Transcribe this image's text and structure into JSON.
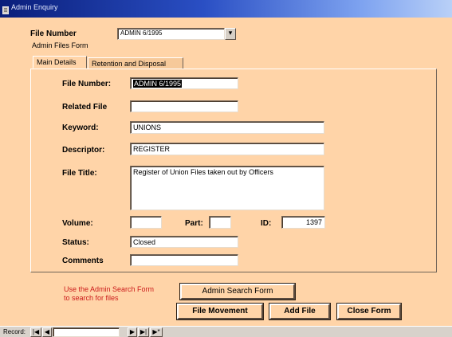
{
  "window": {
    "title": "Admin Enquiry"
  },
  "header": {
    "file_number_label": "File Number",
    "file_number_value": "ADMIN 6/1995",
    "subtitle": "Admin Files Form"
  },
  "tabs": [
    {
      "label": "Main Details"
    },
    {
      "label": "Retention and Disposal"
    }
  ],
  "main": {
    "file_number_label": "File Number:",
    "file_number_value": "ADMIN 6/1995",
    "related_file_label": "Related File",
    "related_file_value": "",
    "keyword_label": "Keyword:",
    "keyword_value": "UNIONS",
    "descriptor_label": "Descriptor:",
    "descriptor_value": "REGISTER",
    "file_title_label": "File Title:",
    "file_title_value": "Register of Union Files taken out by Officers",
    "volume_label": "Volume:",
    "volume_value": "",
    "part_label": "Part:",
    "part_value": "",
    "id_label": "ID:",
    "id_value": "1397",
    "status_label": "Status:",
    "status_value": "Closed",
    "comments_label": "Comments",
    "comments_value": ""
  },
  "footer": {
    "help_text": "Use the Admin Search Form to search for files",
    "admin_search_button": "Admin Search Form",
    "file_movement_button": "File Movement",
    "add_file_button": "Add File",
    "close_form_button": "Close Form"
  },
  "navigation": {
    "record_label": "Record:",
    "first": "|◀",
    "prev": "◀",
    "current": "",
    "next": "▶",
    "last": "▶|",
    "new": "▶*"
  }
}
